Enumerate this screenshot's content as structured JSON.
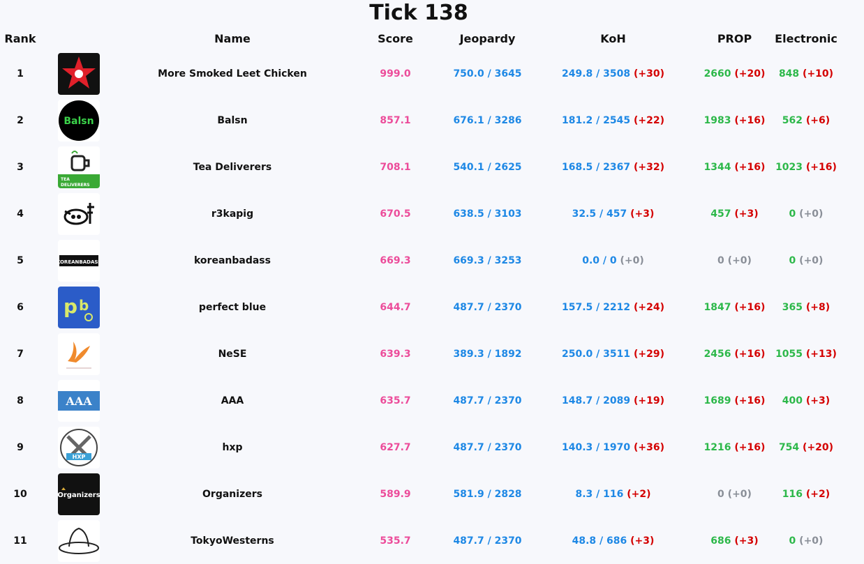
{
  "title": "Tick 138",
  "headers": {
    "rank": "Rank",
    "name": "Name",
    "score": "Score",
    "jeopardy": "Jeopardy",
    "koh": "KoH",
    "prop": "PROP",
    "electronic": "Electronic"
  },
  "colors": {
    "score": "#ec4c9a",
    "jeopardy_koh": "#1e88e5",
    "prop_electronic": "#2db84a",
    "delta_positive": "#d40000",
    "delta_zero": "#8a8f98"
  },
  "rows": [
    {
      "rank": "1",
      "logo": "red-star-chicken-logo",
      "name": "More Smoked Leet Chicken",
      "score": "999.0",
      "jeopardy": "750.0 / 3645",
      "koh": "249.8 / 3508",
      "koh_delta": "(+30)",
      "prop": "2660",
      "prop_delta": "(+20)",
      "electronic": "848",
      "electronic_delta": "(+10)"
    },
    {
      "rank": "2",
      "logo": "balsn-logo",
      "name": "Balsn",
      "score": "857.1",
      "jeopardy": "676.1 / 3286",
      "koh": "181.2 / 2545",
      "koh_delta": "(+22)",
      "prop": "1983",
      "prop_delta": "(+16)",
      "electronic": "562",
      "electronic_delta": "(+6)"
    },
    {
      "rank": "3",
      "logo": "tea-deliverers-logo",
      "logo_text": "TEA DELIVERERS",
      "name": "Tea Deliverers",
      "score": "708.1",
      "jeopardy": "540.1 / 2625",
      "koh": "168.5 / 2367",
      "koh_delta": "(+32)",
      "prop": "1344",
      "prop_delta": "(+16)",
      "electronic": "1023",
      "electronic_delta": "(+16)"
    },
    {
      "rank": "4",
      "logo": "r3kapig-logo",
      "name": "r3kapig",
      "score": "670.5",
      "jeopardy": "638.5 / 3103",
      "koh": "32.5 / 457",
      "koh_delta": "(+3)",
      "prop": "457",
      "prop_delta": "(+3)",
      "electronic": "0",
      "electronic_delta": "(+0)"
    },
    {
      "rank": "5",
      "logo": "koreanbadass-logo",
      "logo_text": "KOREANBADASS",
      "name": "koreanbadass",
      "score": "669.3",
      "jeopardy": "669.3 / 3253",
      "koh": "0.0 / 0",
      "koh_delta": "(+0)",
      "prop": "0",
      "prop_delta": "(+0)",
      "electronic": "0",
      "electronic_delta": "(+0)"
    },
    {
      "rank": "6",
      "logo": "perfect-blue-logo",
      "name": "perfect blue",
      "score": "644.7",
      "jeopardy": "487.7 / 2370",
      "koh": "157.5 / 2212",
      "koh_delta": "(+24)",
      "prop": "1847",
      "prop_delta": "(+16)",
      "electronic": "365",
      "electronic_delta": "(+8)"
    },
    {
      "rank": "7",
      "logo": "nese-phoenix-logo",
      "name": "NeSE",
      "score": "639.3",
      "jeopardy": "389.3 / 1892",
      "koh": "250.0 / 3511",
      "koh_delta": "(+29)",
      "prop": "2456",
      "prop_delta": "(+16)",
      "electronic": "1055",
      "electronic_delta": "(+13)"
    },
    {
      "rank": "8",
      "logo": "aaa-logo",
      "logo_text": "AAA",
      "name": "AAA",
      "score": "635.7",
      "jeopardy": "487.7 / 2370",
      "koh": "148.7 / 2089",
      "koh_delta": "(+19)",
      "prop": "1689",
      "prop_delta": "(+16)",
      "electronic": "400",
      "electronic_delta": "(+3)"
    },
    {
      "rank": "9",
      "logo": "hxp-axes-logo",
      "logo_text": "HXP",
      "name": "hxp",
      "score": "627.7",
      "jeopardy": "487.7 / 2370",
      "koh": "140.3 / 1970",
      "koh_delta": "(+36)",
      "prop": "1216",
      "prop_delta": "(+16)",
      "electronic": "754",
      "electronic_delta": "(+20)"
    },
    {
      "rank": "10",
      "logo": "organizers-logo",
      "logo_text": "Organizers",
      "name": "Organizers",
      "score": "589.9",
      "jeopardy": "581.9 / 2828",
      "koh": "8.3 / 116",
      "koh_delta": "(+2)",
      "prop": "0",
      "prop_delta": "(+0)",
      "electronic": "116",
      "electronic_delta": "(+2)"
    },
    {
      "rank": "11",
      "logo": "tokyowesterns-hat-logo",
      "name": "TokyoWesterns",
      "score": "535.7",
      "jeopardy": "487.7 / 2370",
      "koh": "48.8 / 686",
      "koh_delta": "(+3)",
      "prop": "686",
      "prop_delta": "(+3)",
      "electronic": "0",
      "electronic_delta": "(+0)"
    }
  ]
}
